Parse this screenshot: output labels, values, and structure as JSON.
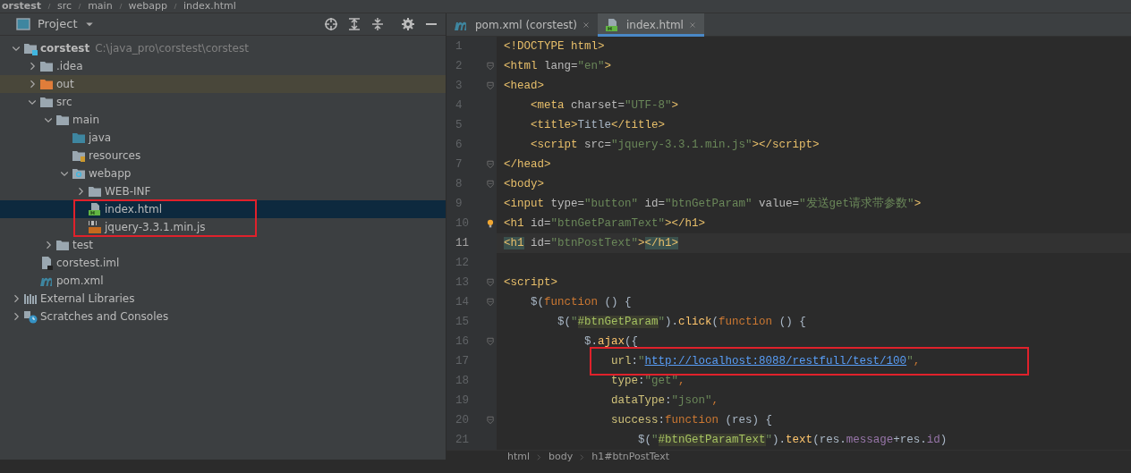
{
  "breadcrumb_top": [
    "orstest",
    "src",
    "main",
    "webapp",
    "index.html"
  ],
  "project_panel": {
    "title": "Project",
    "tree": [
      {
        "label": "corstest",
        "path": "C:\\java_pro\\corstest\\corstest",
        "kind": "module",
        "expanded": true,
        "selected": false,
        "children": [
          {
            "label": ".idea",
            "kind": "folder",
            "expanded": false,
            "selected": false
          },
          {
            "label": "out",
            "kind": "excluded-folder",
            "expanded": false,
            "selected": false,
            "excluded": true
          },
          {
            "label": "src",
            "kind": "folder",
            "expanded": true,
            "selected": false,
            "children": [
              {
                "label": "main",
                "kind": "folder",
                "expanded": true,
                "selected": false,
                "children": [
                  {
                    "label": "java",
                    "kind": "source-folder",
                    "selected": false
                  },
                  {
                    "label": "resources",
                    "kind": "resource-folder",
                    "selected": false
                  },
                  {
                    "label": "webapp",
                    "kind": "web-folder",
                    "expanded": true,
                    "selected": false,
                    "children": [
                      {
                        "label": "WEB-INF",
                        "kind": "folder",
                        "expanded": false,
                        "selected": false
                      },
                      {
                        "label": "index.html",
                        "kind": "html-file",
                        "selected": true,
                        "boxed": true
                      },
                      {
                        "label": "jquery-3.3.1.min.js",
                        "kind": "js-file",
                        "selected": false,
                        "boxed": true
                      }
                    ]
                  }
                ]
              },
              {
                "label": "test",
                "kind": "folder",
                "expanded": false,
                "selected": false
              }
            ]
          },
          {
            "label": "corstest.iml",
            "kind": "iml-file",
            "selected": false
          },
          {
            "label": "pom.xml",
            "kind": "maven-file",
            "selected": false
          }
        ]
      },
      {
        "label": "External Libraries",
        "kind": "libraries",
        "expanded": false,
        "selected": false
      },
      {
        "label": "Scratches and Consoles",
        "kind": "scratches",
        "expanded": false,
        "selected": false
      }
    ]
  },
  "editor_tabs": [
    {
      "label": "pom.xml (corstest)",
      "kind": "maven-file",
      "selected": false
    },
    {
      "label": "index.html",
      "kind": "html-file",
      "selected": true
    }
  ],
  "code_lines": [
    {
      "number": "1",
      "tokens": [
        {
          "kind": "tag",
          "text": "<!DOCTYPE html>"
        }
      ]
    },
    {
      "number": "2",
      "fold": true,
      "tokens": [
        {
          "kind": "tag",
          "text": "<html"
        },
        {
          "kind": "attr",
          "text": " lang="
        },
        {
          "kind": "str",
          "text": "\"en\""
        },
        {
          "kind": "tag",
          "text": ">"
        }
      ]
    },
    {
      "number": "3",
      "fold": true,
      "tokens": [
        {
          "kind": "tag",
          "text": "<head>"
        }
      ]
    },
    {
      "number": "4",
      "tokens": [
        {
          "kind": "tag",
          "text": "    <meta"
        },
        {
          "kind": "attr",
          "text": " charset="
        },
        {
          "kind": "str",
          "text": "\"UTF-8\""
        },
        {
          "kind": "tag",
          "text": ">"
        }
      ]
    },
    {
      "number": "5",
      "tokens": [
        {
          "kind": "tag",
          "text": "    <title>"
        },
        {
          "kind": "plain",
          "text": "Title"
        },
        {
          "kind": "tag",
          "text": "</title>"
        }
      ]
    },
    {
      "number": "6",
      "tokens": [
        {
          "kind": "tag",
          "text": "    <script"
        },
        {
          "kind": "attr",
          "text": " src="
        },
        {
          "kind": "str",
          "text": "\"jquery-3.3.1.min.js\""
        },
        {
          "kind": "tag",
          "text": "></script>"
        }
      ]
    },
    {
      "number": "7",
      "fold": true,
      "tokens": [
        {
          "kind": "tag",
          "text": "</head>"
        }
      ]
    },
    {
      "number": "8",
      "fold": true,
      "tokens": [
        {
          "kind": "tag",
          "text": "<body>"
        }
      ]
    },
    {
      "number": "9",
      "tokens": [
        {
          "kind": "tag",
          "text": "<input"
        },
        {
          "kind": "attr",
          "text": " type="
        },
        {
          "kind": "str",
          "text": "\"button\""
        },
        {
          "kind": "attr",
          "text": " id="
        },
        {
          "kind": "str",
          "text": "\"btnGetParam\""
        },
        {
          "kind": "attr",
          "text": " value="
        },
        {
          "kind": "str",
          "text": "\"发送get请求带参数\""
        },
        {
          "kind": "tag",
          "text": ">"
        }
      ]
    },
    {
      "number": "10",
      "intention": true,
      "tokens": [
        {
          "kind": "tag",
          "text": "<h1"
        },
        {
          "kind": "attr",
          "text": " id="
        },
        {
          "kind": "str",
          "text": "\"btnGetParamText\""
        },
        {
          "kind": "tag",
          "text": "></h1>"
        }
      ]
    },
    {
      "number": "11",
      "current": true,
      "tokens": [
        {
          "kind": "match",
          "text": "<h1"
        },
        {
          "kind": "attr",
          "text": " id="
        },
        {
          "kind": "str",
          "text": "\"btnPostText\""
        },
        {
          "kind": "tag",
          "text": ">"
        },
        {
          "kind": "match",
          "text": "</h1>"
        }
      ]
    },
    {
      "number": "12"
    },
    {
      "number": "13",
      "fold": true,
      "tokens": [
        {
          "kind": "tag",
          "text": "<script>"
        }
      ]
    },
    {
      "number": "14",
      "fold": true,
      "tokens": [
        {
          "kind": "plain",
          "text": "    $("
        },
        {
          "kind": "kw",
          "text": "function"
        },
        {
          "kind": "plain",
          "text": " () {"
        }
      ]
    },
    {
      "number": "15",
      "tokens": [
        {
          "kind": "plain",
          "text": "        $("
        },
        {
          "kind": "str",
          "text": "\""
        },
        {
          "kind": "sel",
          "text": "#btnGetParam"
        },
        {
          "kind": "str",
          "text": "\""
        },
        {
          "kind": "plain",
          "text": ")."
        },
        {
          "kind": "fn",
          "text": "click"
        },
        {
          "kind": "plain",
          "text": "("
        },
        {
          "kind": "kw",
          "text": "function"
        },
        {
          "kind": "plain",
          "text": " () {"
        }
      ]
    },
    {
      "number": "16",
      "fold": true,
      "tokens": [
        {
          "kind": "plain",
          "text": "            $."
        },
        {
          "kind": "fn",
          "text": "ajax"
        },
        {
          "kind": "plain",
          "text": "({"
        }
      ]
    },
    {
      "number": "17",
      "boxed": true,
      "tokens": [
        {
          "kind": "prop",
          "text": "                url"
        },
        {
          "kind": "plain",
          "text": ":"
        },
        {
          "kind": "str",
          "text": "\""
        },
        {
          "kind": "url",
          "text": "http://localhost:8088/restfull/test/100"
        },
        {
          "kind": "str",
          "text": "\""
        },
        {
          "kind": "kw",
          "text": ","
        }
      ]
    },
    {
      "number": "18",
      "tokens": [
        {
          "kind": "prop",
          "text": "                type"
        },
        {
          "kind": "plain",
          "text": ":"
        },
        {
          "kind": "str",
          "text": "\"get\""
        },
        {
          "kind": "kw",
          "text": ","
        }
      ]
    },
    {
      "number": "19",
      "tokens": [
        {
          "kind": "prop",
          "text": "                dataType"
        },
        {
          "kind": "plain",
          "text": ":"
        },
        {
          "kind": "str",
          "text": "\"json\""
        },
        {
          "kind": "kw",
          "text": ","
        }
      ]
    },
    {
      "number": "20",
      "fold": true,
      "tokens": [
        {
          "kind": "prop",
          "text": "                success"
        },
        {
          "kind": "plain",
          "text": ":"
        },
        {
          "kind": "kw",
          "text": "function"
        },
        {
          "kind": "plain",
          "text": " (res) {"
        }
      ]
    },
    {
      "number": "21",
      "tokens": [
        {
          "kind": "plain",
          "text": "                    $("
        },
        {
          "kind": "str",
          "text": "\""
        },
        {
          "kind": "sel",
          "text": "#btnGetParamText"
        },
        {
          "kind": "str",
          "text": "\""
        },
        {
          "kind": "plain",
          "text": ")."
        },
        {
          "kind": "fn",
          "text": "text"
        },
        {
          "kind": "plain",
          "text": "(res."
        },
        {
          "kind": "field",
          "text": "message"
        },
        {
          "kind": "plain",
          "text": "+res."
        },
        {
          "kind": "field",
          "text": "id"
        },
        {
          "kind": "plain",
          "text": ")"
        }
      ]
    }
  ],
  "breadcrumb_bottom": [
    "html",
    "body",
    "h1#btnPostText"
  ]
}
